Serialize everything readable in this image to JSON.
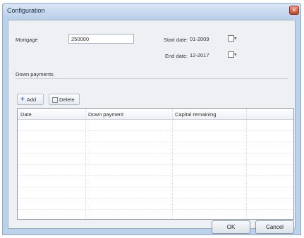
{
  "window": {
    "title": "Configuration",
    "close_glyph": "✕"
  },
  "form": {
    "mortgage_label": "Mortgage",
    "mortgage_value": "250000",
    "start_date_label": "Start date:",
    "start_date_value": "01-2009",
    "end_date_label": "End date:",
    "end_date_value": "12-2017"
  },
  "down_payments": {
    "group_title": "Down payments",
    "add_label": "Add",
    "delete_label": "Delete",
    "columns": [
      "Date",
      "Down payment",
      "Capital remaining"
    ],
    "rows": []
  },
  "buttons": {
    "ok_label": "OK",
    "cancel_label": "Cancel"
  },
  "icons": {
    "add": "plus-icon",
    "delete": "delete-icon",
    "calendar": "calendar-icon",
    "close": "close-icon"
  }
}
